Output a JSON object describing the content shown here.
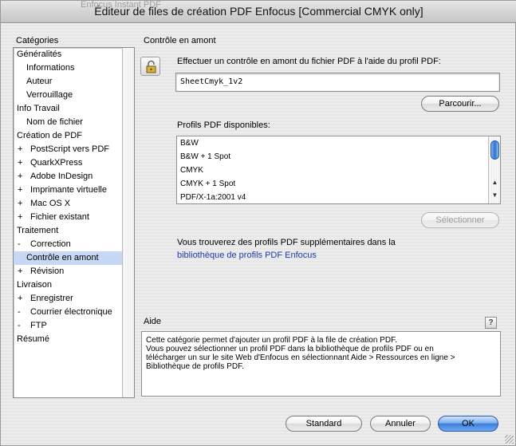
{
  "window": {
    "title": "Éditeur de files de création PDF Enfocus [Commercial CMYK only]",
    "behind_title": "Enfocus Instant PDF"
  },
  "categories": {
    "heading": "Catégories",
    "items": [
      {
        "label": "Généralités",
        "prefix": ""
      },
      {
        "label": "Informations",
        "prefix": ""
      },
      {
        "label": "Auteur",
        "prefix": ""
      },
      {
        "label": "Verrouillage",
        "prefix": ""
      },
      {
        "label": "Info Travail",
        "prefix": ""
      },
      {
        "label": "Nom de fichier",
        "prefix": ""
      },
      {
        "label": "Création de PDF",
        "prefix": ""
      },
      {
        "label": "PostScript vers PDF",
        "prefix": "+"
      },
      {
        "label": "QuarkXPress",
        "prefix": "+"
      },
      {
        "label": "Adobe InDesign",
        "prefix": "+"
      },
      {
        "label": "Imprimante virtuelle",
        "prefix": "+"
      },
      {
        "label": "Mac OS X",
        "prefix": "+"
      },
      {
        "label": "Fichier existant",
        "prefix": "+"
      },
      {
        "label": "Traitement",
        "prefix": ""
      },
      {
        "label": "Correction",
        "prefix": "-"
      },
      {
        "label": "Contrôle en amont",
        "prefix": ""
      },
      {
        "label": "Révision",
        "prefix": "+"
      },
      {
        "label": "Livraison",
        "prefix": ""
      },
      {
        "label": "Enregistrer",
        "prefix": "+"
      },
      {
        "label": "Courrier électronique",
        "prefix": "-"
      },
      {
        "label": "FTP",
        "prefix": "-"
      },
      {
        "label": "Résumé",
        "prefix": ""
      }
    ]
  },
  "preflight": {
    "section_title": "Contrôle en amont",
    "instruction": "Effectuer un contrôle en amont du fichier PDF à l'aide du profil PDF:",
    "profile_value": "SheetCmyk_1v2",
    "browse_label": "Parcourir...",
    "available_label": "Profils PDF disponibles:",
    "profiles": [
      "B&W",
      "B&W + 1 Spot",
      "CMYK",
      "CMYK + 1 Spot",
      "PDF/X-1a:2001 v4"
    ],
    "select_label": "Sélectionner",
    "more_text": "Vous trouverez des profils PDF supplémentaires dans la",
    "library_link": "bibliothèque de profils PDF Enfocus"
  },
  "help": {
    "title": "Aide",
    "question_mark": "?",
    "lines": [
      "Cette catégorie permet d'ajouter un profil PDF à la file de création PDF.",
      "Vous pouvez sélectionner un profil PDF dans la bibliothèque de profils PDF ou en",
      "télécharger un sur le site Web d'Enfocus en sélectionnant Aide > Ressources en ligne >",
      "Bibliothèque de profils PDF."
    ]
  },
  "buttons": {
    "standard": "Standard",
    "cancel": "Annuler",
    "ok": "OK"
  },
  "colors": {
    "selection": "#c7d8f5",
    "link": "#1c3aa8",
    "default_button": "#3b7fdc"
  }
}
